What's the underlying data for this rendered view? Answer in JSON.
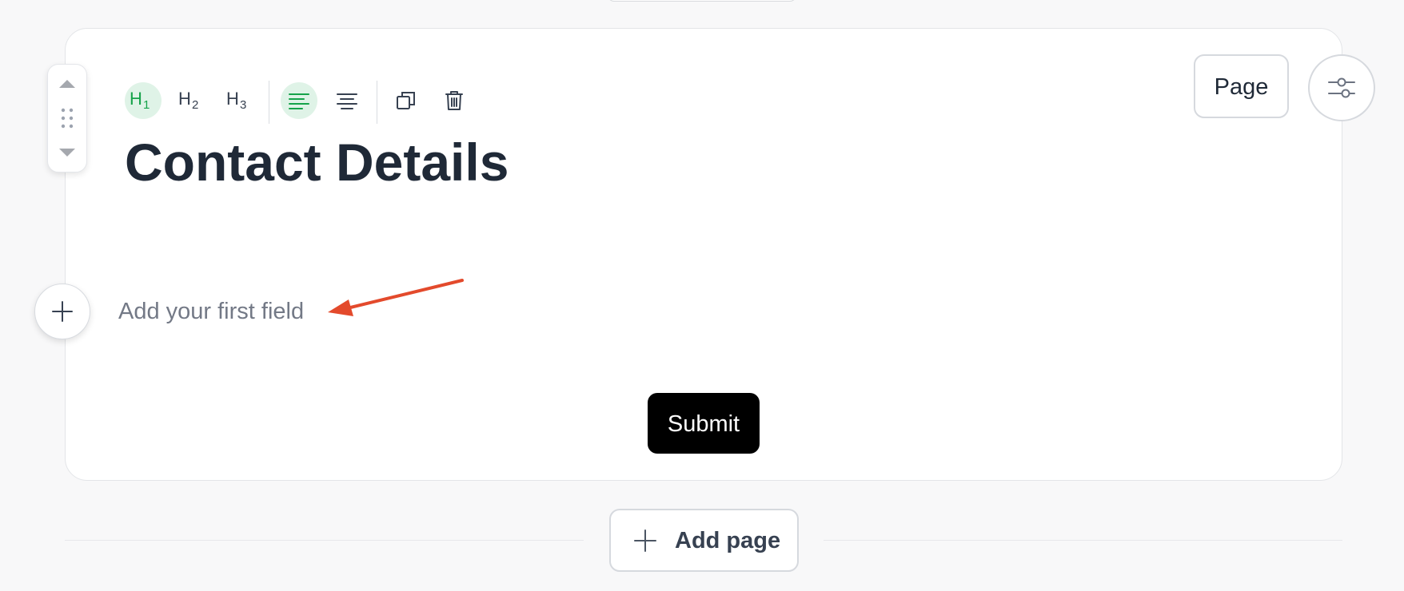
{
  "page": {
    "heading": "Contact Details",
    "placeholder": "Add your first field",
    "submit_label": "Submit",
    "page_button_label": "Page",
    "add_page_label": "Add page"
  },
  "toolbar": {
    "items": [
      {
        "icon": "heading-1-icon",
        "label": "H",
        "subscript": "1",
        "active": true
      },
      {
        "icon": "heading-2-icon",
        "label": "H",
        "subscript": "2",
        "active": false
      },
      {
        "icon": "heading-3-icon",
        "label": "H",
        "subscript": "3",
        "active": false
      },
      {
        "icon": "align-left-icon",
        "active": true
      },
      {
        "icon": "align-center-icon",
        "active": false
      },
      {
        "icon": "duplicate-icon",
        "active": false
      },
      {
        "icon": "trash-icon",
        "active": false
      }
    ]
  },
  "colors": {
    "accent_green": "#16a34a",
    "active_bg": "#dff3e7",
    "annotation_red": "#e34a2c",
    "submit_bg": "#000000"
  }
}
